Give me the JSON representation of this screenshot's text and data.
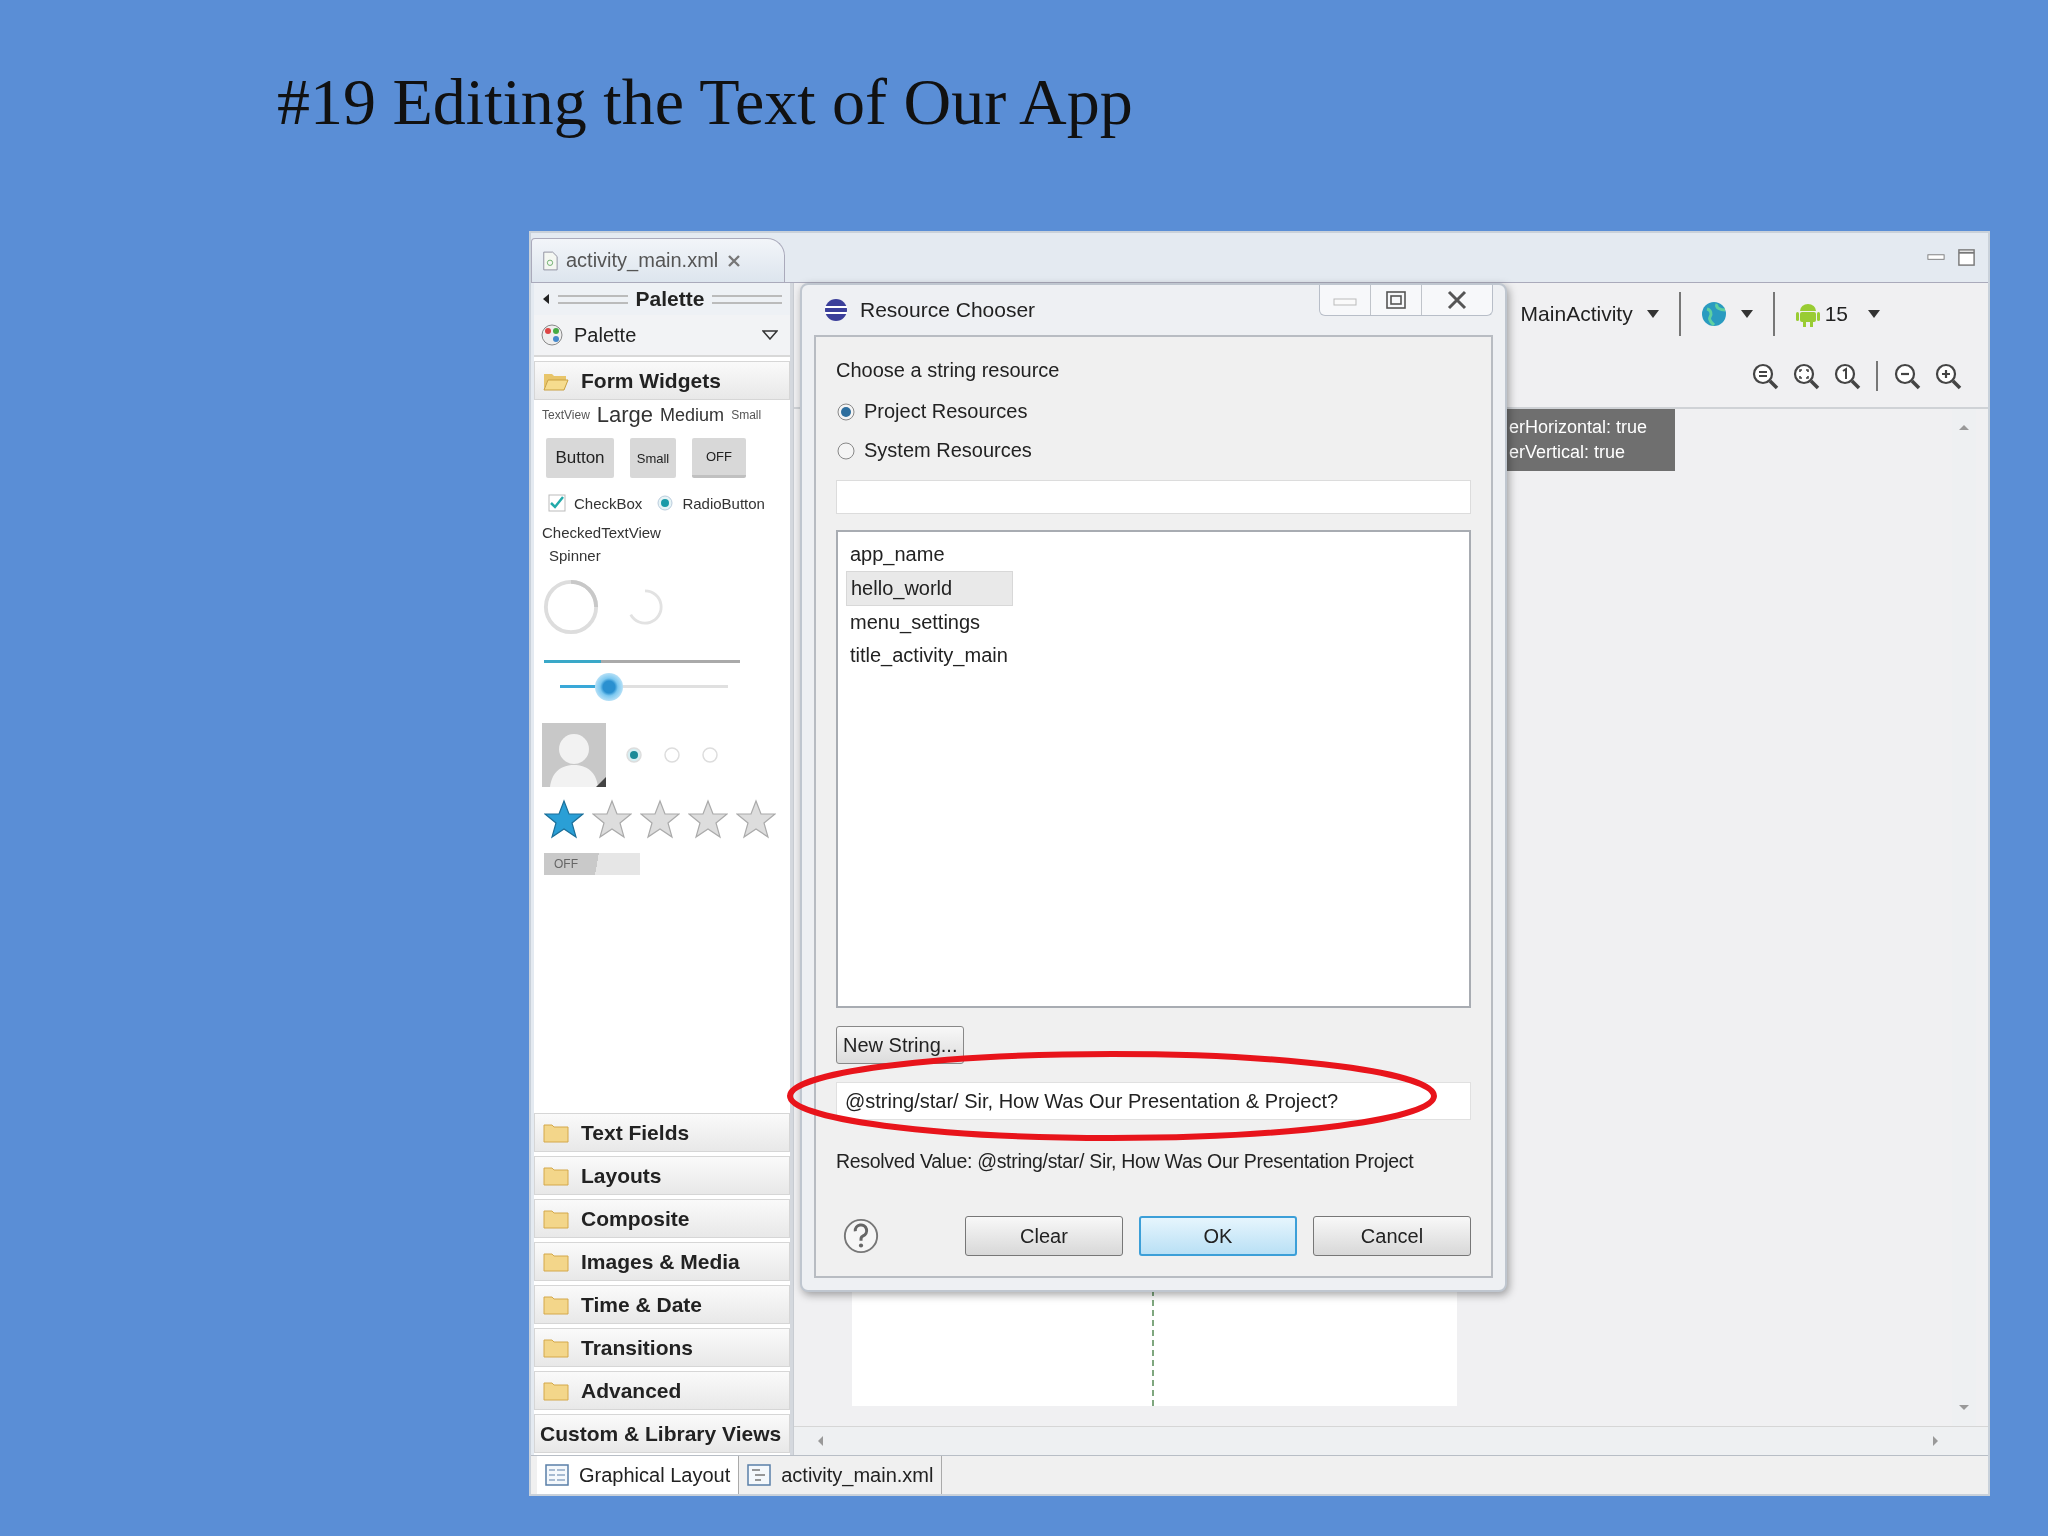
{
  "slide": {
    "title": "#19 Editing the Text of Our App"
  },
  "editor_tab": {
    "label": "activity_main.xml"
  },
  "palette": {
    "header": "Palette",
    "selector": "Palette",
    "open_category": "Form Widgets",
    "text_sizes": [
      {
        "label": "TextView",
        "kind": "tiny"
      },
      {
        "label": "Large",
        "kind": "large"
      },
      {
        "label": "Medium",
        "kind": "medium"
      },
      {
        "label": "Small",
        "kind": "small"
      }
    ],
    "buttons": [
      {
        "label": "Button",
        "kind": "normal"
      },
      {
        "label": "Small",
        "kind": "small"
      },
      {
        "label": "OFF",
        "kind": "toggle"
      }
    ],
    "checkbox": {
      "label": "CheckBox",
      "checked": true
    },
    "radio": {
      "label": "RadioButton",
      "selected": true
    },
    "checked_text": "CheckedTextView",
    "spinner": "Spinner",
    "progress": {
      "level": 0.29
    },
    "seekbar": {
      "level": 0.29
    },
    "radio_group": [
      {
        "selected": true
      },
      {
        "selected": false
      },
      {
        "selected": false
      }
    ],
    "rating": {
      "stars": 1
    },
    "switch": {
      "label": "OFF",
      "on": false
    },
    "categories": [
      {
        "label": "Text Fields"
      },
      {
        "label": "Layouts"
      },
      {
        "label": "Composite"
      },
      {
        "label": "Images & Media"
      },
      {
        "label": "Time & Date"
      },
      {
        "label": "Transitions"
      },
      {
        "label": "Advanced"
      }
    ],
    "custom": "Custom & Library Views"
  },
  "toolbar": {
    "activity": "MainActivity",
    "api": "15"
  },
  "layout_hint": [
    "erHorizontal: true",
    "erVertical: true"
  ],
  "dialog": {
    "title": "Resource Chooser",
    "prompt": "Choose a string resource",
    "options": [
      {
        "label": "Project Resources",
        "selected": true
      },
      {
        "label": "System Resources",
        "selected": false
      }
    ],
    "items": [
      {
        "label": "app_name",
        "selected": false
      },
      {
        "label": "hello_world",
        "selected": true
      },
      {
        "label": "menu_settings",
        "selected": false
      },
      {
        "label": "title_activity_main",
        "selected": false
      }
    ],
    "new_button": "New String...",
    "value": "@string/star/ Sir, How Was Our Presentation & Project?",
    "resolved": "Resolved Value: @string/star/ Sir, How Was Our Presentation  Project",
    "buttons": [
      {
        "label": "Clear",
        "default": false
      },
      {
        "label": "OK",
        "default": true
      },
      {
        "label": "Cancel",
        "default": false
      }
    ]
  },
  "bottom_tabs": [
    {
      "label": "Graphical Layout",
      "selected": true
    },
    {
      "label": "activity_main.xml",
      "selected": false
    }
  ]
}
